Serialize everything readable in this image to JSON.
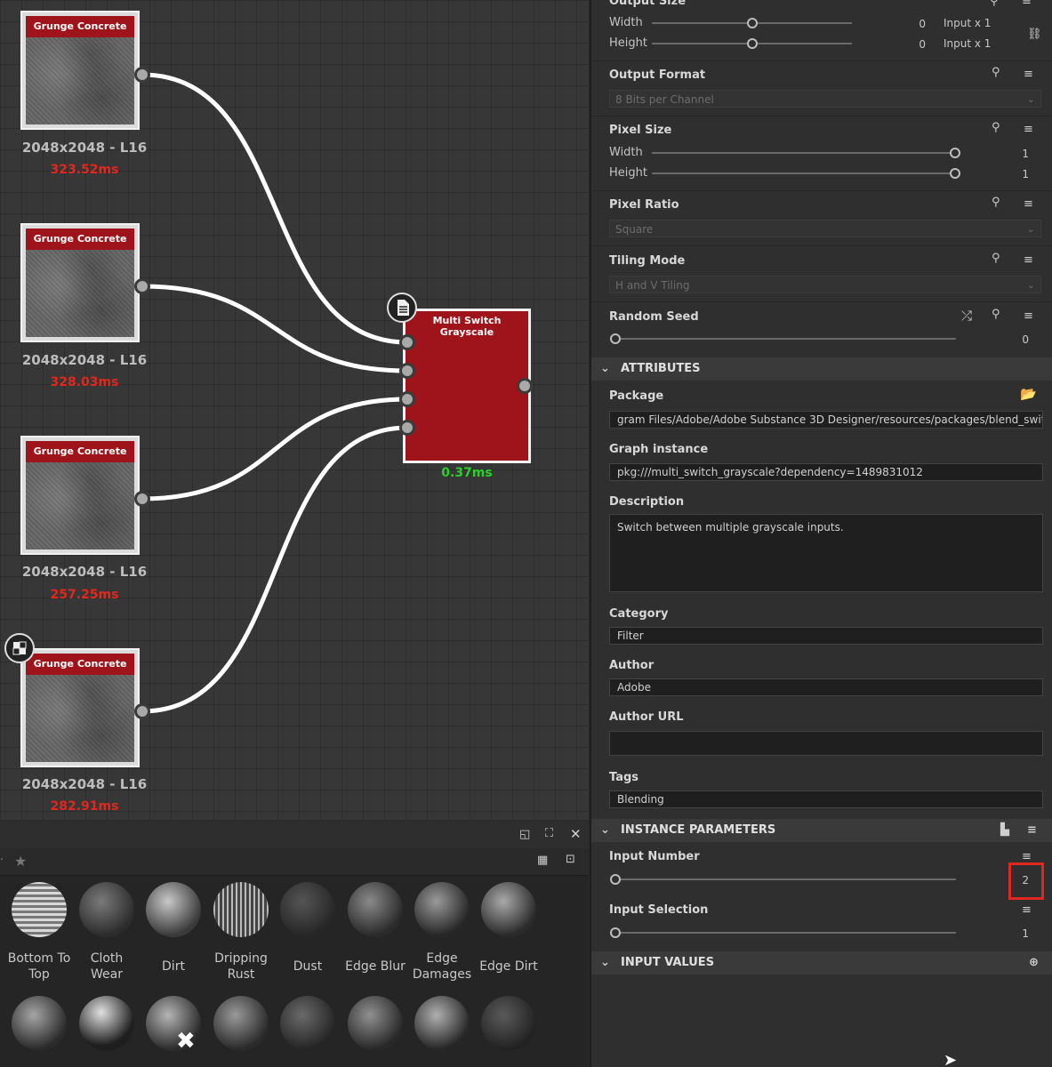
{
  "nodes": [
    {
      "title": "Grunge Concrete",
      "info": "2048x2048 - L16",
      "time": "323.52ms"
    },
    {
      "title": "Grunge Concrete",
      "info": "2048x2048 - L16",
      "time": "328.03ms"
    },
    {
      "title": "Grunge Concrete",
      "info": "2048x2048 - L16",
      "time": "257.25ms"
    },
    {
      "title": "Grunge Concrete",
      "info": "2048x2048 - L16",
      "time": "282.91ms"
    }
  ],
  "switch_node": {
    "title": "Multi Switch Grayscale",
    "time": "0.37ms"
  },
  "library": {
    "tiles": [
      {
        "label": "Bottom To Top"
      },
      {
        "label": "Cloth Wear"
      },
      {
        "label": "Dirt"
      },
      {
        "label": "Dripping Rust"
      },
      {
        "label": "Dust"
      },
      {
        "label": "Edge Blur"
      },
      {
        "label": "Edge Damages"
      },
      {
        "label": "Edge Dirt"
      }
    ]
  },
  "panel": {
    "output_size": {
      "title": "Output Size",
      "width_label": "Width",
      "width_value": "0",
      "width_mode": "Input x 1",
      "height_label": "Height",
      "height_value": "0",
      "height_mode": "Input x 1"
    },
    "output_format": {
      "title": "Output Format",
      "value": "8 Bits per Channel"
    },
    "pixel_size": {
      "title": "Pixel Size",
      "width_label": "Width",
      "width_value": "1",
      "height_label": "Height",
      "height_value": "1"
    },
    "pixel_ratio": {
      "title": "Pixel Ratio",
      "value": "Square"
    },
    "tiling_mode": {
      "title": "Tiling Mode",
      "value": "H and V Tiling"
    },
    "random_seed": {
      "title": "Random Seed",
      "value": "0"
    },
    "attributes": {
      "header": "ATTRIBUTES",
      "package_label": "Package",
      "package_value": "gram Files/Adobe/Adobe Substance 3D Designer/resources/packages/blend_switch.sbs",
      "graph_label": "Graph instance",
      "graph_value": "pkg:///multi_switch_grayscale?dependency=1489831012",
      "description_label": "Description",
      "description_value": "Switch between multiple grayscale inputs.",
      "category_label": "Category",
      "category_value": "Filter",
      "author_label": "Author",
      "author_value": "Adobe",
      "author_url_label": "Author URL",
      "author_url_value": "",
      "tags_label": "Tags",
      "tags_value": "Blending"
    },
    "instance": {
      "header": "INSTANCE PARAMETERS",
      "input_number_label": "Input Number",
      "input_number_value": "2",
      "input_selection_label": "Input Selection",
      "input_selection_value": "1"
    },
    "input_values": {
      "header": "INPUT VALUES"
    }
  },
  "colors": {
    "node_header": "#9f141a",
    "time_red": "#e0281e",
    "time_green": "#2ad12a",
    "highlight": "#e0281e"
  }
}
